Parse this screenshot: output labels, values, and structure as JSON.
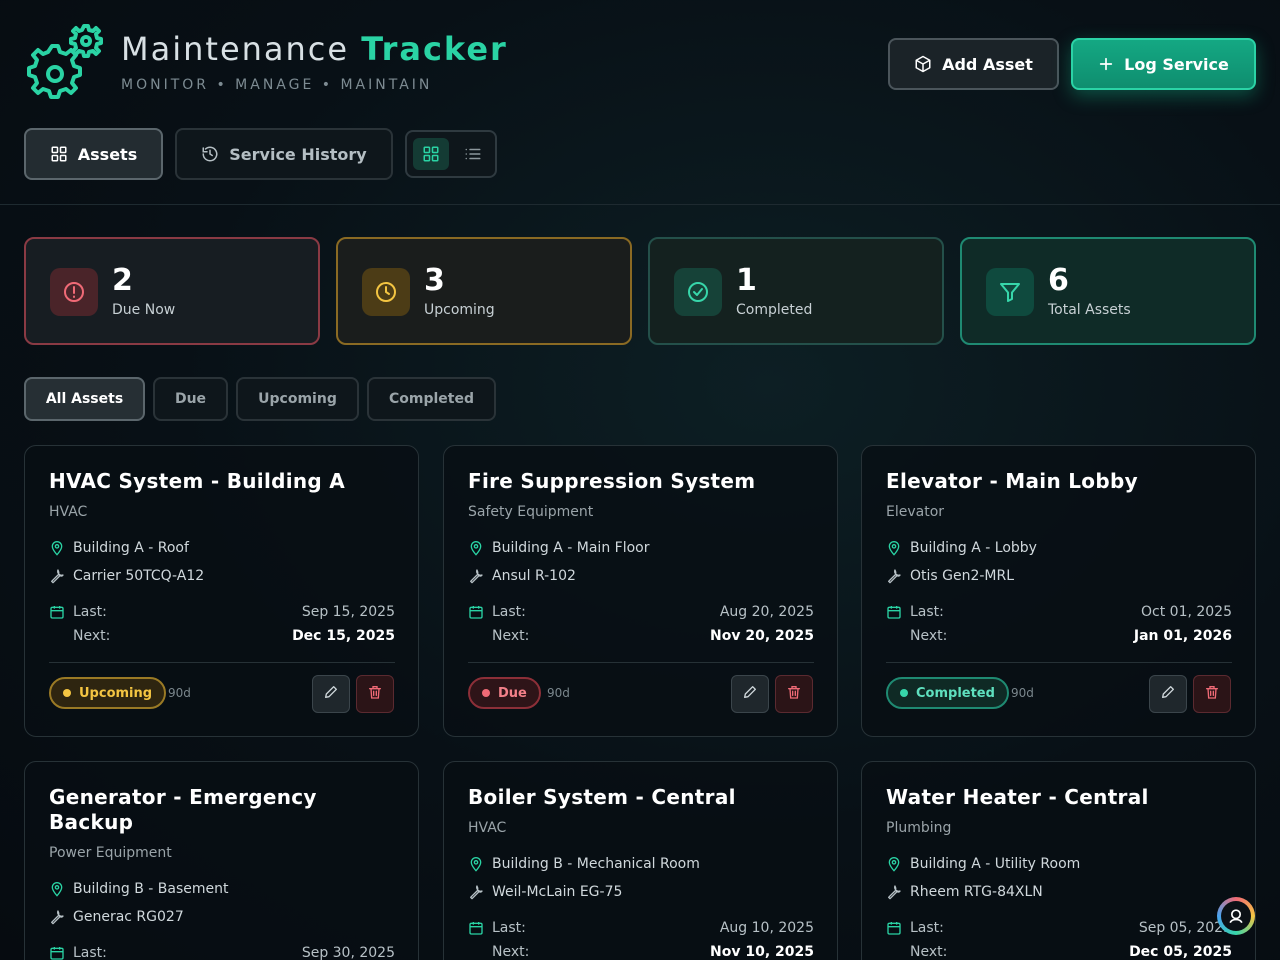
{
  "app": {
    "title_prefix": "Maintenance",
    "title_accent": "Tracker",
    "subtitle": "MONITOR • MANAGE • MAINTAIN",
    "logo_icon": "gears-icon"
  },
  "actions": {
    "add_asset": "Add Asset",
    "log_service": "Log Service"
  },
  "tabs": [
    {
      "label": "Assets",
      "icon": "grid-icon",
      "active": true
    },
    {
      "label": "Service History",
      "icon": "history-icon",
      "active": false
    }
  ],
  "view_toggle": {
    "selected": "grid",
    "options": [
      "grid-icon",
      "list-icon"
    ]
  },
  "stats": [
    {
      "value": "2",
      "label": "Due Now",
      "icon": "alert-circle-icon",
      "color": "#f06a76"
    },
    {
      "value": "3",
      "label": "Upcoming",
      "icon": "clock-icon",
      "color": "#f4c542"
    },
    {
      "value": "1",
      "label": "Completed",
      "icon": "check-circle-icon",
      "color": "#37d6aa"
    },
    {
      "value": "6",
      "label": "Total Assets",
      "icon": "filter-icon",
      "color": "#37d6aa"
    }
  ],
  "filters": [
    {
      "label": "All Assets",
      "active": true
    },
    {
      "label": "Due",
      "active": false
    },
    {
      "label": "Upcoming",
      "active": false
    },
    {
      "label": "Completed",
      "active": false
    }
  ],
  "labels": {
    "last": "Last:",
    "next": "Next:"
  },
  "assets": [
    {
      "name": "HVAC System - Building A",
      "category": "HVAC",
      "location": "Building A - Roof",
      "model": "Carrier 50TCQ-A12",
      "last": "Sep 15, 2025",
      "next": "Dec 15, 2025",
      "status": "Upcoming",
      "interval": "90d"
    },
    {
      "name": "Fire Suppression System",
      "category": "Safety Equipment",
      "location": "Building A - Main Floor",
      "model": "Ansul R-102",
      "last": "Aug 20, 2025",
      "next": "Nov 20, 2025",
      "status": "Due",
      "interval": "90d"
    },
    {
      "name": "Elevator - Main Lobby",
      "category": "Elevator",
      "location": "Building A - Lobby",
      "model": "Otis Gen2-MRL",
      "last": "Oct 01, 2025",
      "next": "Jan 01, 2026",
      "status": "Completed",
      "interval": "90d"
    },
    {
      "name": "Generator - Emergency Backup",
      "category": "Power Equipment",
      "location": "Building B - Basement",
      "model": "Generac RG027",
      "last": "Sep 30, 2025",
      "next": "",
      "status": "",
      "interval": ""
    },
    {
      "name": "Boiler System - Central",
      "category": "HVAC",
      "location": "Building B - Mechanical Room",
      "model": "Weil-McLain EG-75",
      "last": "Aug 10, 2025",
      "next": "Nov 10, 2025",
      "status": "",
      "interval": ""
    },
    {
      "name": "Water Heater - Central",
      "category": "Plumbing",
      "location": "Building A - Utility Room",
      "model": "Rheem RTG-84XLN",
      "last": "Sep 05, 2025",
      "next": "Dec 05, 2025",
      "status": "",
      "interval": ""
    }
  ],
  "colors": {
    "accent": "#2ad3a4",
    "due": "#f06a76",
    "upcoming": "#f4c542",
    "completed": "#37d6aa"
  }
}
